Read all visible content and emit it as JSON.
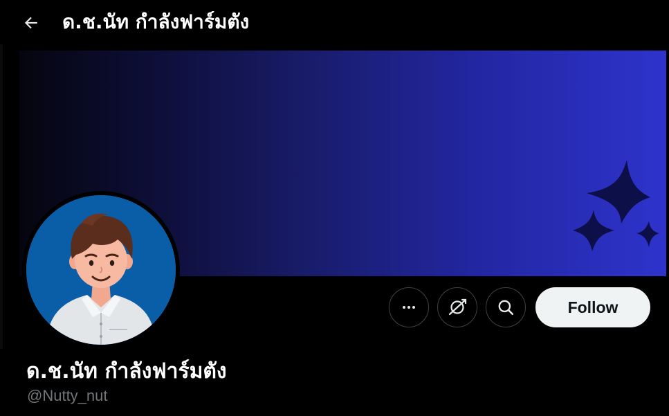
{
  "header": {
    "back_icon": "arrow-left-icon",
    "title": "ด.ช.นัท กำลังฟาร์มตัง"
  },
  "banner": {
    "gradient_start": "#05050f",
    "gradient_end": "#2e33cc",
    "decoration_icon": "sparkles-icon"
  },
  "avatar": {
    "description_icon": "cartoon-boy-avatar-icon",
    "background": "#0a5ea8"
  },
  "actions": {
    "more_icon": "ellipsis-icon",
    "subscribe_icon": "subscribe-icon",
    "search_icon": "search-icon",
    "follow_label": "Follow"
  },
  "profile": {
    "display_name": "ด.ช.นัท กำลังฟาร์มตัง",
    "handle": "@Nutty_nut"
  }
}
